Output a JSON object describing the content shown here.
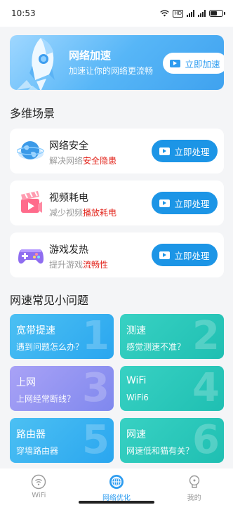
{
  "status_bar": {
    "time": "10:53",
    "hd": "HD"
  },
  "banner": {
    "title": "网络加速",
    "subtitle": "加速让你的网络更流畅",
    "button": "立即加速",
    "icon": "rocket-icon",
    "gradient": [
      "#9fd7ff",
      "#3fa2ef"
    ]
  },
  "scenes": {
    "title": "多维场景",
    "items": [
      {
        "title": "网络安全",
        "desc_prefix": "解决网络",
        "desc_highlight": "安全隐患",
        "button": "立即处理",
        "icon": "globe-shield-icon"
      },
      {
        "title": "视频耗电",
        "desc_prefix": "减少视频",
        "desc_highlight": "播放耗电",
        "button": "立即处理",
        "icon": "video-clapper-icon"
      },
      {
        "title": "游戏发热",
        "desc_prefix": "提升游戏",
        "desc_highlight": "流畅性",
        "button": "立即处理",
        "icon": "gamepad-icon"
      }
    ],
    "highlight_color": "#e2231a",
    "button_color": "#1c95e6"
  },
  "faq": {
    "title": "网速常见小问题",
    "tiles": [
      {
        "title": "宽带提速",
        "sub": "遇到问题怎么办？",
        "num": "1",
        "color": "blue"
      },
      {
        "title": "测速",
        "sub": "感觉测速不准？",
        "num": "2",
        "color": "teal"
      },
      {
        "title": "上网",
        "sub": "上网经常断线？",
        "num": "3",
        "color": "purple"
      },
      {
        "title": "WiFi",
        "sub": "WiFi6",
        "num": "4",
        "color": "teal"
      },
      {
        "title": "路由器",
        "sub": "穿墙路由器",
        "num": "5",
        "color": "blue"
      },
      {
        "title": "网速",
        "sub": "网速低和猫有关？",
        "num": "6",
        "color": "teal"
      }
    ]
  },
  "tabbar": {
    "items": [
      {
        "label": "WiFi",
        "icon": "wifi-icon",
        "active": false
      },
      {
        "label": "网络优化",
        "icon": "network-optimize-icon",
        "active": true
      },
      {
        "label": "我的",
        "icon": "profile-icon",
        "active": false
      }
    ],
    "active_color": "#2d9cf0"
  }
}
